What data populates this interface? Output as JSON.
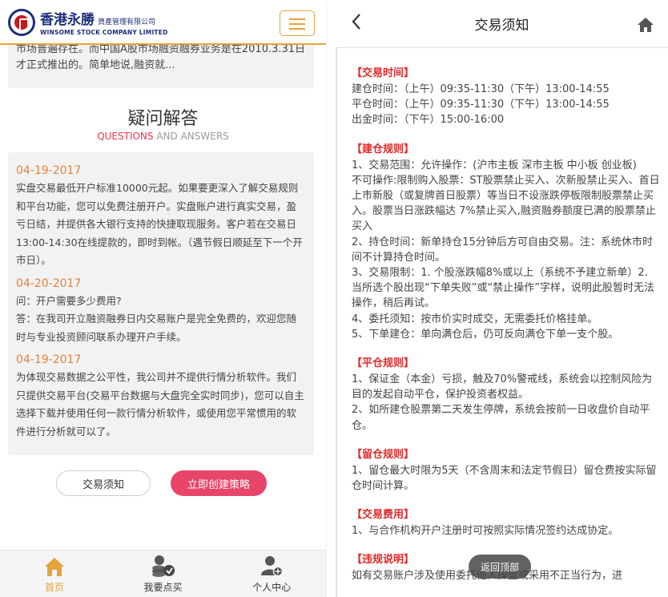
{
  "left": {
    "logo": {
      "cn": "香港永勝",
      "cn_small": "資產管理有限公司",
      "en": "WINSOME STOCK COMPANY LIMITED"
    },
    "intro_text": "市场普遍存在。而中国A股市场融资融券业务是在2010.3.31日才正式推出的。简单地说,融资就...",
    "qa": {
      "title": "疑问解答",
      "sub_red": "QUESTIONS",
      "sub_rest": " AND ANSWERS",
      "items": [
        {
          "date": "04-19-2017",
          "text": "实盘交易最低开户标准10000元起。如果要更深入了解交易规则和平台功能，您可以免费注册开户。实盘账户进行真实交易，盈亏日结，并提供各大银行支持的快捷取现服务。客户若在交易日13:00-14:30在线提款的，即时到帐。（遇节假日顺延至下一个开市日）。"
        },
        {
          "date": "04-20-2017",
          "text": "问：开户需要多少费用?\n答：在我司开立融资融券日内交易账户是完全免费的，欢迎您随时与专业投资顾问联系办理开户手续。"
        },
        {
          "date": "04-19-2017",
          "text": "为体现交易数据之公平性，我公司并不提供行情分析软件。我们只提供交易平台(交易平台数据与大盘完全实时同步)，您可以自主选择下载并使用任何一款行情分析软件，或使用您平常惯用的软件进行分析就可以了。"
        }
      ]
    },
    "buttons": {
      "rules": "交易须知",
      "create": "立即创建策略"
    },
    "tabs": [
      {
        "label": "首页",
        "icon": "home-icon",
        "active": true
      },
      {
        "label": "我要点买",
        "icon": "coins-icon",
        "active": false
      },
      {
        "label": "个人中心",
        "icon": "user-icon",
        "active": false
      }
    ]
  },
  "right": {
    "title": "交易须知",
    "back_glyph": "<",
    "back_to_top": "返回顶部",
    "sections": [
      {
        "title": "【交易时间】",
        "lines": [
          "建仓时间：（上午）09:35-11:30（下午）13:00-14:55",
          "平仓时间：（上午）09:35-11:30（下午）13:00-14:55",
          "出金时间：（下午）15:00-16:00"
        ]
      },
      {
        "title": "【建仓规则】",
        "lines": [
          "1、交易范围：允许操作：(沪市主板 深市主板 中小板 创业板)",
          " 不可操作:限制购入股票：ST股票禁止买入、次新股禁止买入、首日上市新股（或复牌首日股票）等当日不设涨跌停板限制股票禁止买入。股票当日涨跌幅达 7%禁止买入,融资融券额度已满的股票禁止买入",
          "2、持仓时间：新单持仓15分钟后方可自由交易。注：系统休市时间不计算持仓时间。",
          "3、交易限制：1. 个股涨跌幅8%或以上（系统不予建立新单）2. 当所选个股出现“下单失败”或“禁止操作”字样，说明此股暂时无法操作，稍后再试。",
          "4、委托须知：按市价实时成交，无需委托价格挂单。",
          "5、下单建仓：单向满仓后，仍可反向满仓下单一支个股。"
        ]
      },
      {
        "title": "【平仓规则】",
        "lines": [
          "1、保证金（本金）亏损，触及70%警戒线，系统会以控制风险为目的发起自动平仓，保护投资者权益。",
          "2、如所建仓股票第二天发生停牌，系统会按前一日收盘价自动平仓。"
        ]
      },
      {
        "title": "【留仓规则】",
        "lines": [
          "1、留仓最大时限为5天（不含周末和法定节假日）留仓费按实际留仓时间计算。"
        ]
      },
      {
        "title": "【交易费用】",
        "lines": [
          "1、与合作机构开户注册时可按照实际情况签约达成协定。"
        ]
      },
      {
        "title": "【违规说明】",
        "lines": [
          "如有交易账户涉及使用委托他人操盘或采用不正当行为，进"
        ]
      }
    ]
  },
  "colors": {
    "accent": "#e6a23c",
    "brand_blue": "#1c2f7a",
    "pink_button": "#e8456a",
    "section_red": "#e02a2a"
  }
}
